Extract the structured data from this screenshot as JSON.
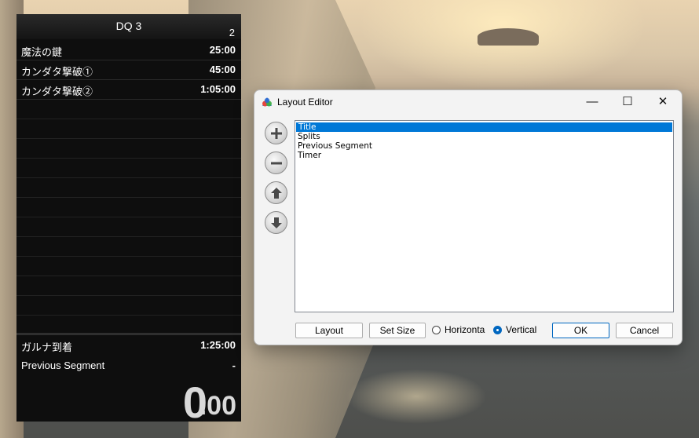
{
  "splits_panel": {
    "title": "DQ 3",
    "attempt_count": "2",
    "segments": [
      {
        "name": "魔法の鍵",
        "time": "25:00"
      },
      {
        "name": "カンダタ撃破①",
        "time": "45:00"
      },
      {
        "name": "カンダタ撃破②",
        "time": "1:05:00"
      }
    ],
    "final_segment": {
      "name": "ガルナ到着",
      "time": "1:25:00"
    },
    "previous_segment": {
      "label": "Previous Segment",
      "value": "-"
    },
    "timer": {
      "main": "0",
      "fraction": ".00"
    }
  },
  "layout_editor": {
    "window_title": "Layout Editor",
    "window_controls": {
      "minimize": "—",
      "maximize": "☐",
      "close": "✕"
    },
    "side_buttons": [
      "add-icon",
      "remove-icon",
      "move-up-icon",
      "move-down-icon"
    ],
    "components": [
      "Title",
      "Splits",
      "Previous Segment",
      "Timer"
    ],
    "selected_index": 0,
    "layout_button": "Layout",
    "set_size_button": "Set Size",
    "orientation": {
      "horizontal_label": "Horizonta",
      "vertical_label": "Vertical",
      "selected": "Vertical"
    },
    "ok_button": "OK",
    "cancel_button": "Cancel",
    "colors": {
      "selection": "#0078d7",
      "accent": "#0067c0"
    }
  }
}
